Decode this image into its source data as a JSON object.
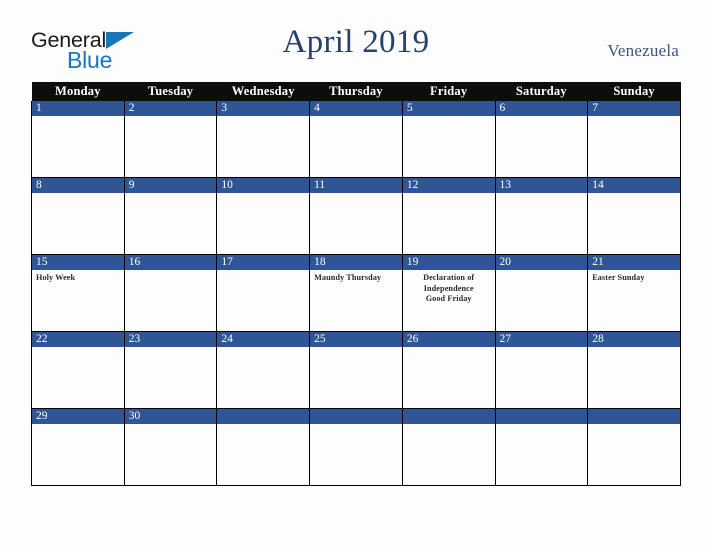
{
  "brand": {
    "logo_word_1": "General",
    "logo_word_2": "Blue",
    "logo_triangle_icon": "triangle-icon",
    "accent_color": "#1B75BB"
  },
  "header": {
    "title": "April 2019",
    "country": "Venezuela",
    "title_color": "#26416B",
    "country_color": "#3F5578"
  },
  "calendar": {
    "month": "April",
    "year": "2019",
    "week_start": "Monday",
    "header_bg": "#0D0D0D",
    "daybar_bg": "#2F5597",
    "weekdays": [
      "Monday",
      "Tuesday",
      "Wednesday",
      "Thursday",
      "Friday",
      "Saturday",
      "Sunday"
    ],
    "weeks": [
      [
        {
          "date": "1",
          "events": []
        },
        {
          "date": "2",
          "events": []
        },
        {
          "date": "3",
          "events": []
        },
        {
          "date": "4",
          "events": []
        },
        {
          "date": "5",
          "events": []
        },
        {
          "date": "6",
          "events": []
        },
        {
          "date": "7",
          "events": []
        }
      ],
      [
        {
          "date": "8",
          "events": []
        },
        {
          "date": "9",
          "events": []
        },
        {
          "date": "10",
          "events": []
        },
        {
          "date": "11",
          "events": []
        },
        {
          "date": "12",
          "events": []
        },
        {
          "date": "13",
          "events": []
        },
        {
          "date": "14",
          "events": []
        }
      ],
      [
        {
          "date": "15",
          "events": [
            {
              "name": "Holy Week",
              "align": "left"
            }
          ]
        },
        {
          "date": "16",
          "events": []
        },
        {
          "date": "17",
          "events": []
        },
        {
          "date": "18",
          "events": [
            {
              "name": "Maundy Thursday",
              "align": "left"
            }
          ]
        },
        {
          "date": "19",
          "events": [
            {
              "name": "Declaration of Independence",
              "align": "center"
            },
            {
              "name": "Good Friday",
              "align": "center"
            }
          ]
        },
        {
          "date": "20",
          "events": []
        },
        {
          "date": "21",
          "events": [
            {
              "name": "Easter Sunday",
              "align": "left"
            }
          ]
        }
      ],
      [
        {
          "date": "22",
          "events": []
        },
        {
          "date": "23",
          "events": []
        },
        {
          "date": "24",
          "events": []
        },
        {
          "date": "25",
          "events": []
        },
        {
          "date": "26",
          "events": []
        },
        {
          "date": "27",
          "events": []
        },
        {
          "date": "28",
          "events": []
        }
      ],
      [
        {
          "date": "29",
          "events": []
        },
        {
          "date": "30",
          "events": []
        },
        {
          "date": "",
          "events": []
        },
        {
          "date": "",
          "events": []
        },
        {
          "date": "",
          "events": []
        },
        {
          "date": "",
          "events": []
        },
        {
          "date": "",
          "events": []
        }
      ]
    ]
  }
}
